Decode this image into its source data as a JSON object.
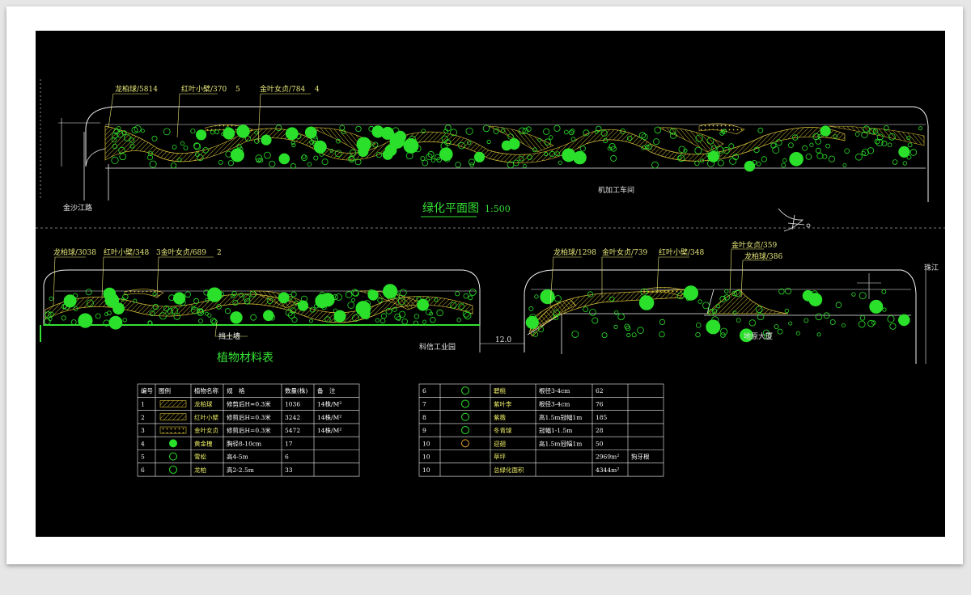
{
  "drawing": {
    "title": "绿化平面图",
    "scale": "1:500",
    "table_title": "植物材料表",
    "road_left": "金沙江路",
    "road_right": "珠江",
    "building_top": "机加工车间",
    "building_mid": "科信工业园",
    "building_right": "地原大厦",
    "retaining_wall": "挡土墙",
    "dimension": "12.0"
  },
  "callouts": {
    "top": [
      "龙柏球/5814",
      "红叶小檗/370",
      "5",
      "金叶女贞/784",
      "4"
    ],
    "bottom_left": [
      "龙柏球/3038",
      "红叶小檗/348",
      "3金叶女贞/689",
      "2"
    ],
    "bottom_right": [
      "龙柏球/1298",
      "金叶女贞/739",
      "红叶小檗/348",
      "金叶女贞/359",
      "龙柏球/386"
    ]
  },
  "table1": {
    "headers": [
      "编号",
      "图例",
      "植物名称",
      "规　格",
      "数量(株)",
      "备　注"
    ],
    "rows": [
      [
        "1",
        "",
        "龙柏球",
        "修剪后H=0.3米",
        "1036",
        "14株/M²"
      ],
      [
        "2",
        "",
        "红叶小檗",
        "修剪后H=0.3米",
        "3242",
        "14株/M²"
      ],
      [
        "3",
        "",
        "金叶女贞",
        "修剪后H=0.3米",
        "5472",
        "14株/M²"
      ],
      [
        "4",
        "",
        "黄金槐",
        "胸径8-10cm",
        "17",
        ""
      ],
      [
        "5",
        "",
        "雪松",
        "高4-5m",
        "6",
        ""
      ],
      [
        "6",
        "",
        "龙柏",
        "高2-2.5m",
        "33",
        ""
      ]
    ]
  },
  "table2": {
    "rows": [
      [
        "6",
        "",
        "碧桃",
        "根径3-4cm",
        "62",
        ""
      ],
      [
        "7",
        "",
        "紫叶李",
        "根径3-4cm",
        "76",
        ""
      ],
      [
        "8",
        "",
        "紫薇",
        "高1.5m冠幅1m",
        "185",
        ""
      ],
      [
        "9",
        "",
        "冬青球",
        "冠幅1-1.5m",
        "28",
        ""
      ],
      [
        "10",
        "",
        "迎翅",
        "高1.5m冠幅1m",
        "50",
        ""
      ],
      [
        "10",
        "",
        "草坪",
        "",
        "2969m²",
        "狗牙根"
      ],
      [
        "10",
        "",
        "总绿化面积",
        "",
        "4344m²",
        ""
      ]
    ]
  },
  "colors": {
    "background": "#000000",
    "outline": "#f2f2f2",
    "hatch": "#d9c23a",
    "plant": "#2be02b",
    "label": "#e8e87a",
    "leader": "#e8e87a"
  }
}
